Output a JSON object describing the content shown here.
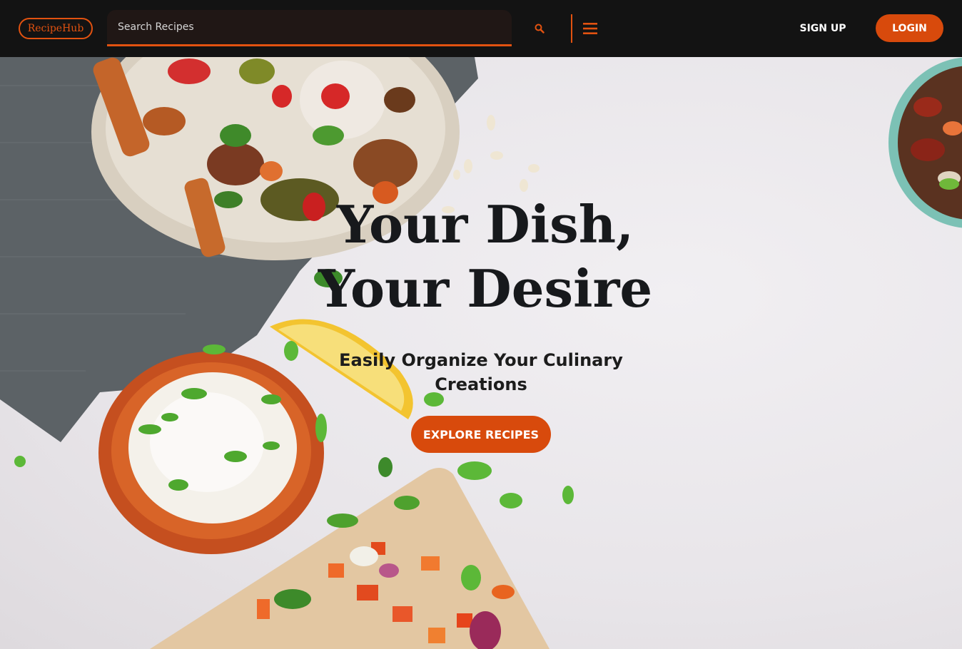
{
  "navbar": {
    "logo_text": "RecipeHub",
    "search": {
      "placeholder": "Search Recipes",
      "value": ""
    },
    "search_icon": "search-icon",
    "menu_icon": "hamburger-menu-icon",
    "signup_label": "SIGN UP",
    "login_label": "LOGIN"
  },
  "hero": {
    "title_line1": "Your Dish,",
    "title_line2": "Your Desire",
    "subtitle": "Easily Organize Your Culinary Creations",
    "cta_label": "EXPLORE RECIPES",
    "background_image": "food-flatlay-photo"
  },
  "colors": {
    "accent": "#d84a0c",
    "navbar_bg": "#131313",
    "title_text": "#17191c"
  }
}
